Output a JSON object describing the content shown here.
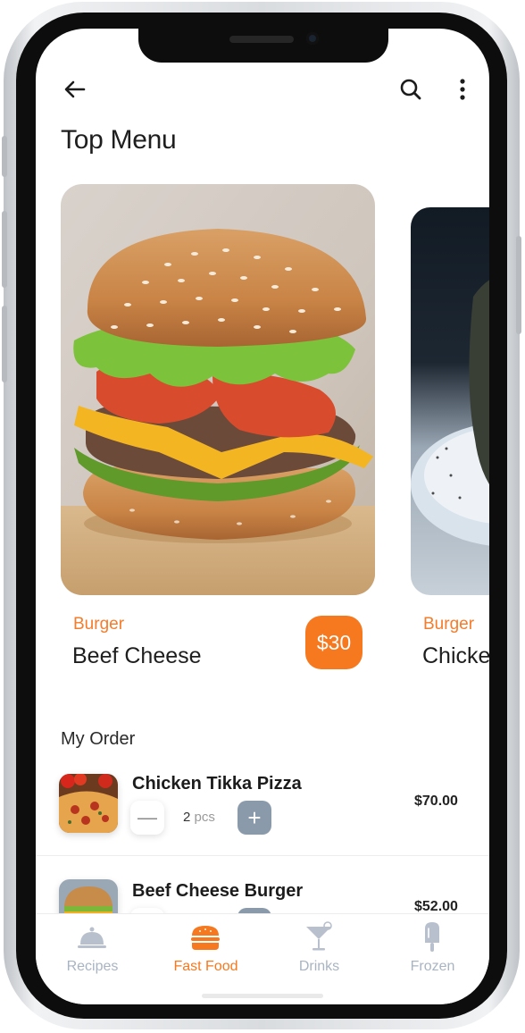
{
  "header": {
    "back_icon": "arrow-left-icon",
    "search_icon": "search-icon",
    "more_icon": "more-vertical-icon",
    "title": "Top Menu"
  },
  "featured": [
    {
      "category": "Burger",
      "name": "Beef Cheese",
      "price": "$30"
    },
    {
      "category": "Burger",
      "name": "Chicke"
    }
  ],
  "orders": {
    "title": "My Order",
    "items": [
      {
        "name": "Chicken Tikka Pizza",
        "qty": "2",
        "unit": "pcs",
        "price": "$70.00"
      },
      {
        "name": "Beef Cheese Burger",
        "price": "$52.00"
      }
    ]
  },
  "tabs": [
    {
      "label": "Recipes",
      "icon": "cloche-icon",
      "active": false
    },
    {
      "label": "Fast Food",
      "icon": "burger-icon",
      "active": true
    },
    {
      "label": "Drinks",
      "icon": "cocktail-icon",
      "active": false
    },
    {
      "label": "Frozen",
      "icon": "popsicle-icon",
      "active": false
    }
  ],
  "colors": {
    "accent": "#f6791f",
    "inactive_tab": "#a9b4c2",
    "plus_button": "#8a9aab"
  }
}
